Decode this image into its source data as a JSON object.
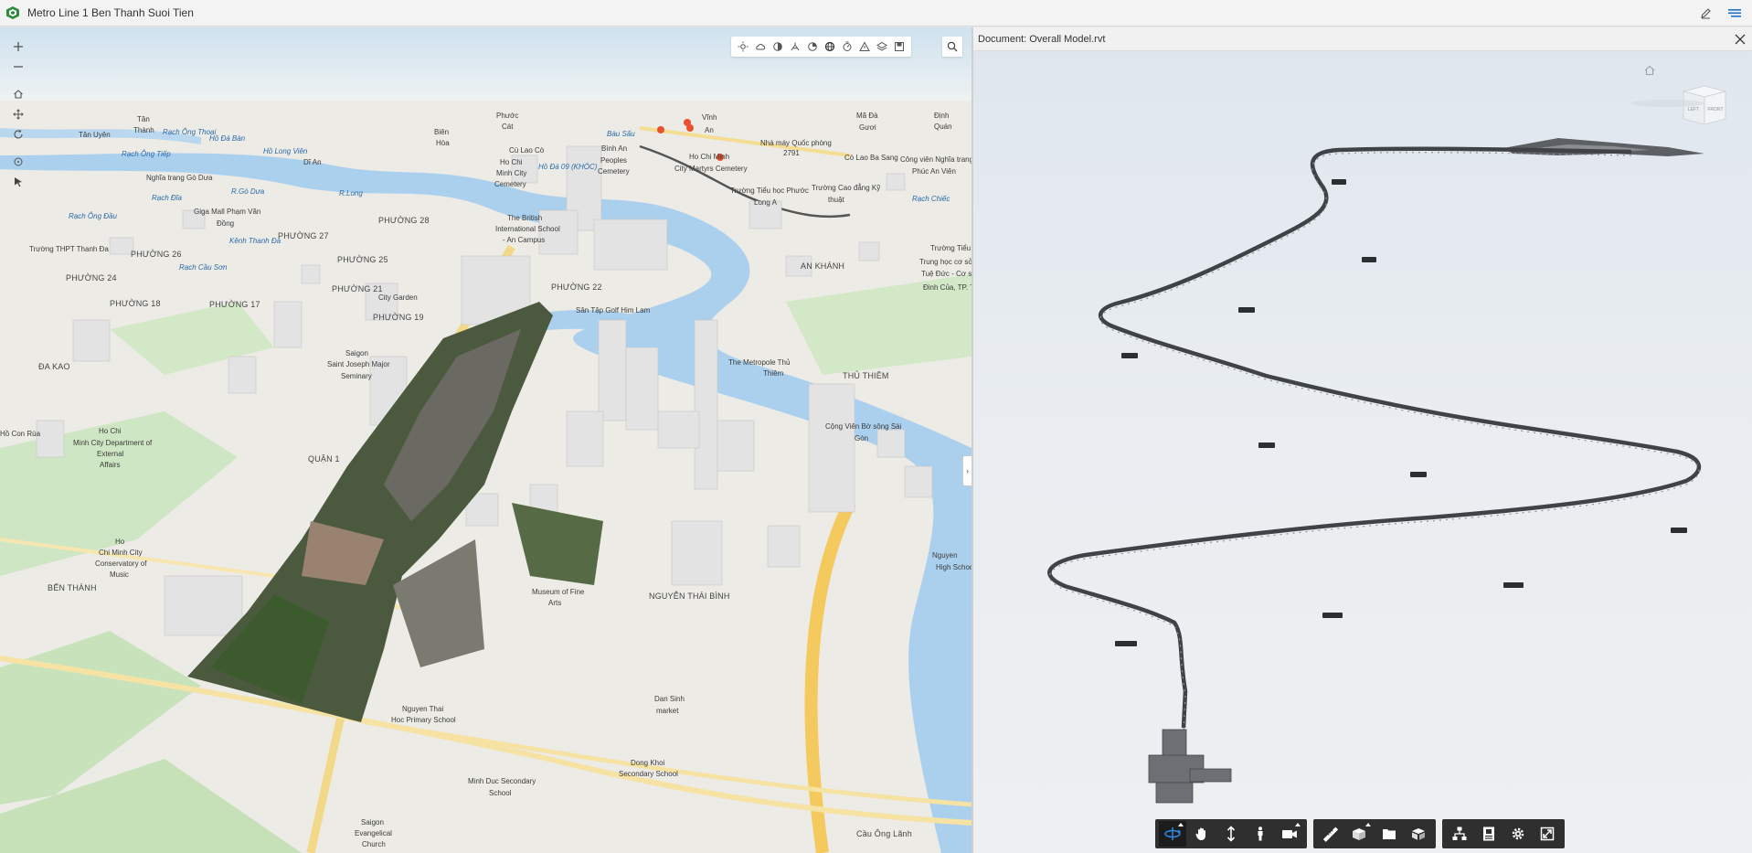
{
  "app": {
    "title": "Metro Line 1 Ben Thanh Suoi Tien",
    "accent": "#2e8b3a"
  },
  "titlebar": {
    "icons": [
      "edit-icon",
      "menu-lines-icon"
    ]
  },
  "map": {
    "left_tools": [
      "zoom-in-icon",
      "zoom-out-icon",
      "home-icon",
      "pan-icon",
      "rotate-icon",
      "compass-icon",
      "select-cursor-icon"
    ],
    "toolbar_icons": [
      "daylight-icon",
      "weather-icon",
      "shadow-icon",
      "measure-icon",
      "slice-icon",
      "basemap-icon",
      "legend-icon",
      "alert-icon",
      "layers-icon",
      "bookmark-icon"
    ],
    "labels": [
      {
        "text": "Tân Uyên",
        "cls": ""
      },
      {
        "text": "Tân",
        "cls": ""
      },
      {
        "text": "Thành",
        "cls": ""
      },
      {
        "text": "Rạch Ông Tiếp",
        "cls": "water"
      },
      {
        "text": "Rạch Ông Thoại",
        "cls": "water"
      },
      {
        "text": "Hồ Đá Bàn",
        "cls": "water"
      },
      {
        "text": "Hồ Long Viên",
        "cls": "water"
      },
      {
        "text": "Dĩ An",
        "cls": ""
      },
      {
        "text": "Biên",
        "cls": ""
      },
      {
        "text": "Hòa",
        "cls": ""
      },
      {
        "text": "Phước",
        "cls": ""
      },
      {
        "text": "Cát",
        "cls": ""
      },
      {
        "text": "Vĩnh",
        "cls": ""
      },
      {
        "text": "An",
        "cls": ""
      },
      {
        "text": "Mã Đà",
        "cls": ""
      },
      {
        "text": "Gươi",
        "cls": ""
      },
      {
        "text": "Định",
        "cls": ""
      },
      {
        "text": "Quán",
        "cls": ""
      },
      {
        "text": "Bàu Sấu",
        "cls": "water"
      },
      {
        "text": "Nhà máy Quốc phòng",
        "cls": ""
      },
      {
        "text": "2791",
        "cls": ""
      },
      {
        "text": "Cò Lao Ba Sang",
        "cls": ""
      },
      {
        "text": "Công viên Nghĩa trang",
        "cls": ""
      },
      {
        "text": "Phúc An Viên",
        "cls": ""
      },
      {
        "text": "Nghĩa trang Gò Dưa",
        "cls": ""
      },
      {
        "text": "R.Gò Dưa",
        "cls": "water"
      },
      {
        "text": "Rạch Đĩa",
        "cls": "water"
      },
      {
        "text": "R.Long",
        "cls": "water"
      },
      {
        "text": "Cù Lao Cò",
        "cls": ""
      },
      {
        "text": "Bình An",
        "cls": ""
      },
      {
        "text": "Ho Chi",
        "cls": ""
      },
      {
        "text": "Minh City",
        "cls": ""
      },
      {
        "text": "Cemetery",
        "cls": ""
      },
      {
        "text": "Hồ Đá 09 (KHÓC)",
        "cls": "water"
      },
      {
        "text": "Peoples",
        "cls": ""
      },
      {
        "text": "Cemetery",
        "cls": ""
      },
      {
        "text": "Ho Chi Minh",
        "cls": ""
      },
      {
        "text": "City Martyrs Cemetery",
        "cls": ""
      },
      {
        "text": "Trường Tiểu học Phước",
        "cls": ""
      },
      {
        "text": "Long A",
        "cls": ""
      },
      {
        "text": "Trường Cao đẳng Kỹ",
        "cls": ""
      },
      {
        "text": "thuật",
        "cls": ""
      },
      {
        "text": "Rạch Chiếc",
        "cls": "water"
      },
      {
        "text": "Giga Mall Phạm Văn",
        "cls": ""
      },
      {
        "text": "Đồng",
        "cls": ""
      },
      {
        "text": "Rạch Ông Đầu",
        "cls": "water"
      },
      {
        "text": "Kênh Thanh Đa",
        "cls": "water"
      },
      {
        "text": "PHƯỜNG 27",
        "cls": "big"
      },
      {
        "text": "PHƯỜNG 28",
        "cls": "big"
      },
      {
        "text": "The British",
        "cls": ""
      },
      {
        "text": "International School",
        "cls": ""
      },
      {
        "text": "- An Campus",
        "cls": ""
      },
      {
        "text": "Trường THPT Thanh Đa",
        "cls": ""
      },
      {
        "text": "PHƯỜNG 26",
        "cls": "big"
      },
      {
        "text": "Rạch Cầu Sơn",
        "cls": "water"
      },
      {
        "text": "PHƯỜNG 25",
        "cls": "big"
      },
      {
        "text": "PHƯỜNG 24",
        "cls": "big"
      },
      {
        "text": "PHƯỜNG 21",
        "cls": "big"
      },
      {
        "text": "PHƯỜNG 22",
        "cls": "big"
      },
      {
        "text": "AN KHÁNH",
        "cls": "big"
      },
      {
        "text": "Trường Tiểu h",
        "cls": ""
      },
      {
        "text": "Trung học cơ sở",
        "cls": ""
      },
      {
        "text": "Tuệ Đức - Cơ sở",
        "cls": ""
      },
      {
        "text": "Đinh Của, TP. Th",
        "cls": ""
      },
      {
        "text": "PHƯỜNG 18",
        "cls": "big"
      },
      {
        "text": "PHƯỜNG 17",
        "cls": "big"
      },
      {
        "text": "City Garden",
        "cls": ""
      },
      {
        "text": "PHƯỜNG 19",
        "cls": "big"
      },
      {
        "text": "Sân Tập Golf Him Lam",
        "cls": ""
      },
      {
        "text": "ĐA KAO",
        "cls": "big"
      },
      {
        "text": "Saigon",
        "cls": ""
      },
      {
        "text": "Saint Joseph Major",
        "cls": ""
      },
      {
        "text": "Seminary",
        "cls": ""
      },
      {
        "text": "The Metropole Thủ",
        "cls": ""
      },
      {
        "text": "Thiêm",
        "cls": ""
      },
      {
        "text": "THỦ THIÊM",
        "cls": "big"
      },
      {
        "text": "Cộng Viên Bờ sông Sài",
        "cls": ""
      },
      {
        "text": "Gòn",
        "cls": ""
      },
      {
        "text": "Ho Chi",
        "cls": ""
      },
      {
        "text": "Minh City Department of",
        "cls": ""
      },
      {
        "text": "External",
        "cls": ""
      },
      {
        "text": "Affairs",
        "cls": ""
      },
      {
        "text": "Hồ Con Rùa",
        "cls": ""
      },
      {
        "text": "QUẬN 1",
        "cls": "big"
      },
      {
        "text": "Ho",
        "cls": ""
      },
      {
        "text": "Chi Minh City",
        "cls": ""
      },
      {
        "text": "Conservatory of",
        "cls": ""
      },
      {
        "text": "Music",
        "cls": ""
      },
      {
        "text": "BẾN THÀNH",
        "cls": "big"
      },
      {
        "text": "Museum of Fine",
        "cls": ""
      },
      {
        "text": "Arts",
        "cls": ""
      },
      {
        "text": "NGUYỄN THÁI BÌNH",
        "cls": "big"
      },
      {
        "text": "Nguyen",
        "cls": ""
      },
      {
        "text": "High Schoo",
        "cls": ""
      },
      {
        "text": "Nguyen Thai",
        "cls": ""
      },
      {
        "text": "Hoc Primary School",
        "cls": ""
      },
      {
        "text": "Dan Sinh",
        "cls": ""
      },
      {
        "text": "market",
        "cls": ""
      },
      {
        "text": "Dong Khoi",
        "cls": ""
      },
      {
        "text": "Secondary School",
        "cls": ""
      },
      {
        "text": "Minh Duc Secondary",
        "cls": ""
      },
      {
        "text": "School",
        "cls": ""
      },
      {
        "text": "Saigon",
        "cls": ""
      },
      {
        "text": "Evangelical",
        "cls": ""
      },
      {
        "text": "Church",
        "cls": ""
      },
      {
        "text": "Cầu Ông Lãnh",
        "cls": "big"
      }
    ]
  },
  "document": {
    "title": "Document: Overall Model.rvt",
    "viewcube_left": "LEFT",
    "viewcube_front": "FRONT"
  },
  "viewer_toolbar": {
    "groups": [
      [
        "orbit-icon",
        "pan-hand-icon",
        "dolly-icon",
        "first-person-icon",
        "camera-icon"
      ],
      [
        "measure-ruler-icon",
        "section-box-icon",
        "model-browser-icon",
        "explode-icon"
      ],
      [
        "structure-tree-icon",
        "properties-icon",
        "settings-gear-icon",
        "fullscreen-icon"
      ]
    ]
  }
}
